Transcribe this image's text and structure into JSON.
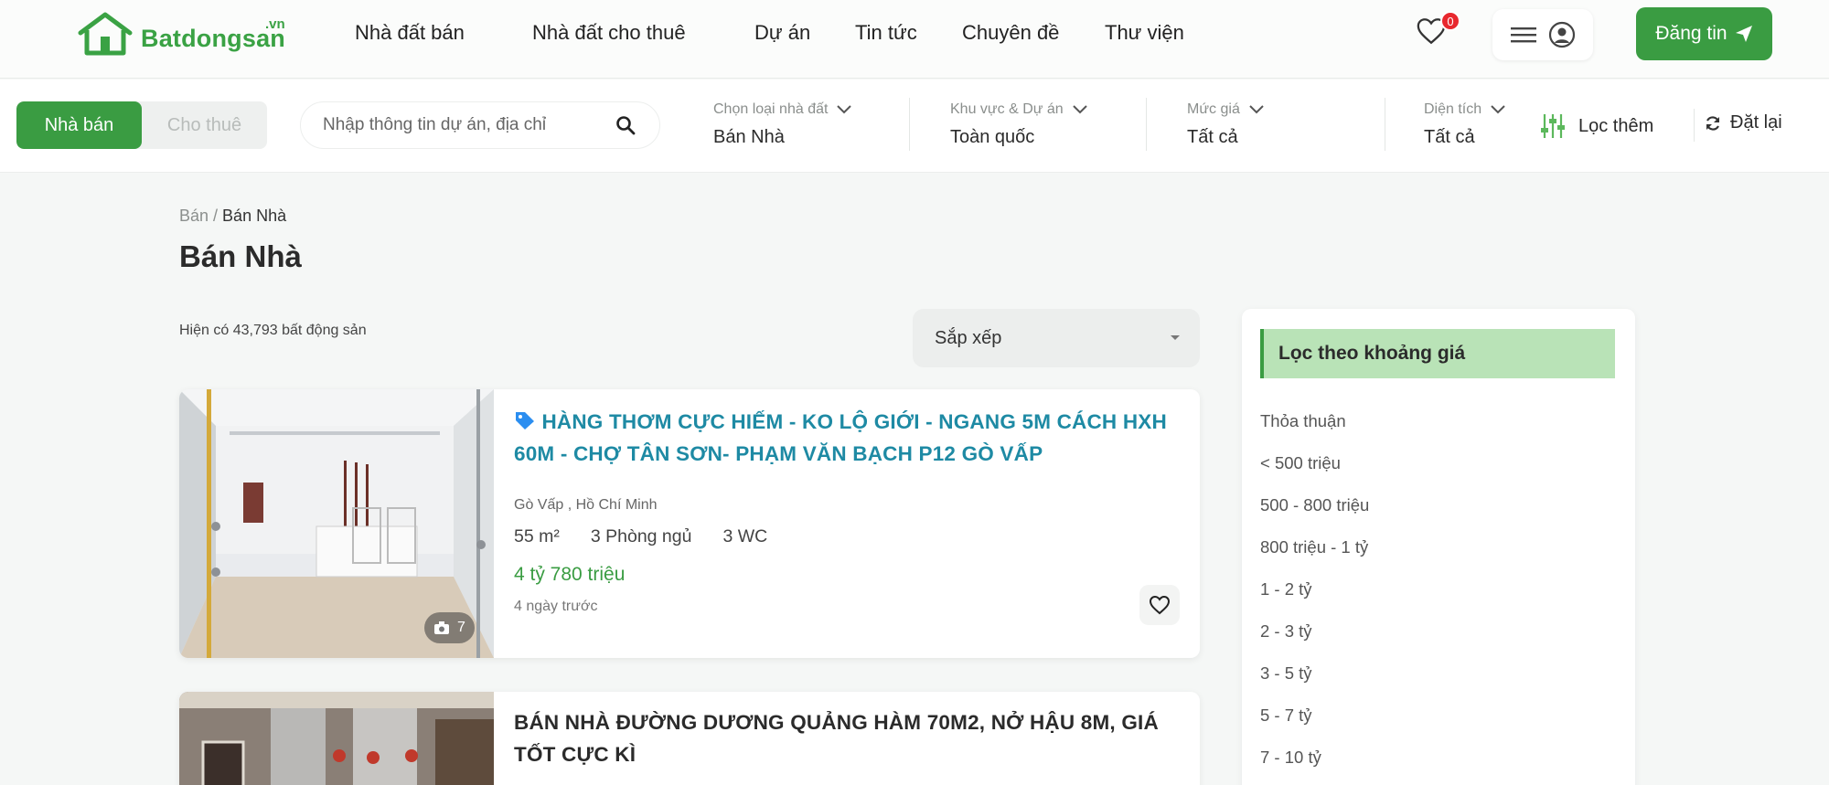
{
  "brand": {
    "name": "Batdongsan",
    "tld": ".vn"
  },
  "nav": {
    "items": [
      "Nhà đất bán",
      "Nhà đất cho thuê",
      "Dự án",
      "Tin tức",
      "Chuyên đề",
      "Thư viện"
    ]
  },
  "header": {
    "favorites_count": "0",
    "post_label": "Đăng tin"
  },
  "filters": {
    "segment": {
      "active": "Nhà bán",
      "inactive": "Cho thuê"
    },
    "search": {
      "placeholder": "Nhập thông tin dự án, địa chỉ"
    },
    "property_type": {
      "label": "Chọn loại nhà đất",
      "value": "Bán Nhà"
    },
    "area_project": {
      "label": "Khu vực & Dự án",
      "value": "Toàn quốc"
    },
    "price": {
      "label": "Mức giá",
      "value": "Tất cả"
    },
    "size": {
      "label": "Diện tích",
      "value": "Tất cả"
    },
    "more_label": "Lọc thêm",
    "reset_label": "Đặt lại"
  },
  "breadcrumb": {
    "parent": "Bán",
    "separator": " / ",
    "current": "Bán Nhà"
  },
  "page": {
    "title": "Bán Nhà",
    "count_text": "Hiện có 43,793 bất động sản"
  },
  "sort": {
    "label": "Sắp xếp"
  },
  "listings": [
    {
      "title": "HÀNG THƠM CỰC HIẾM - KO LỘ GIỚI - NGANG 5M CÁCH HXH 60M - CHỢ TÂN SƠN- PHẠM VĂN BẠCH P12 GÒ VẤP",
      "location": "Gò Vấp , Hồ Chí Minh",
      "area": "55 m²",
      "bedrooms": "3 Phòng ngủ",
      "wc": "3 WC",
      "price": "4 tỷ 780 triệu",
      "posted": "4 ngày trước",
      "photo_count": "7"
    },
    {
      "title": "BÁN NHÀ ĐƯỜNG DƯƠNG QUẢNG HÀM 70M2, NỞ HẬU 8M, GIÁ TỐT CỰC KÌ"
    }
  ],
  "sidebar": {
    "title": "Lọc theo khoảng giá",
    "items": [
      "Thỏa thuận",
      "< 500 triệu",
      "500 - 800 triệu",
      "800 triệu - 1 tỷ",
      "1 - 2 tỷ",
      "2 - 3 tỷ",
      "3 - 5 tỷ",
      "5 - 7 tỷ",
      "7 - 10 tỷ"
    ]
  },
  "colors": {
    "brand_green": "#3a9c42",
    "title_teal": "#1e8aa4",
    "badge_red": "#e8282e"
  }
}
